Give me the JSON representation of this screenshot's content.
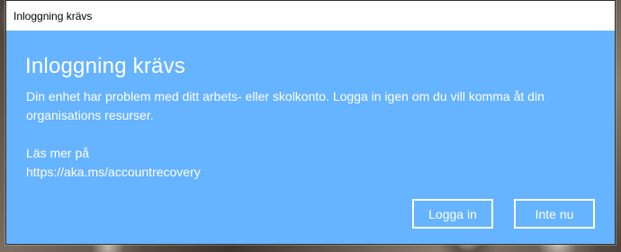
{
  "window": {
    "title": "Inloggning krävs"
  },
  "dialog": {
    "heading": "Inloggning krävs",
    "message": "Din enhet har problem med ditt arbets- eller skolkonto. Logga in igen om du vill komma åt din organisations resurser.",
    "learn_more_label": "Läs mer på",
    "learn_more_url": "https://aka.ms/accountrecovery"
  },
  "buttons": {
    "login_label": "Logga in",
    "cancel_label": "Inte nu"
  },
  "colors": {
    "dialog_background": "#66b3ff",
    "titlebar_background": "#ffffff",
    "text": "#ffffff"
  }
}
